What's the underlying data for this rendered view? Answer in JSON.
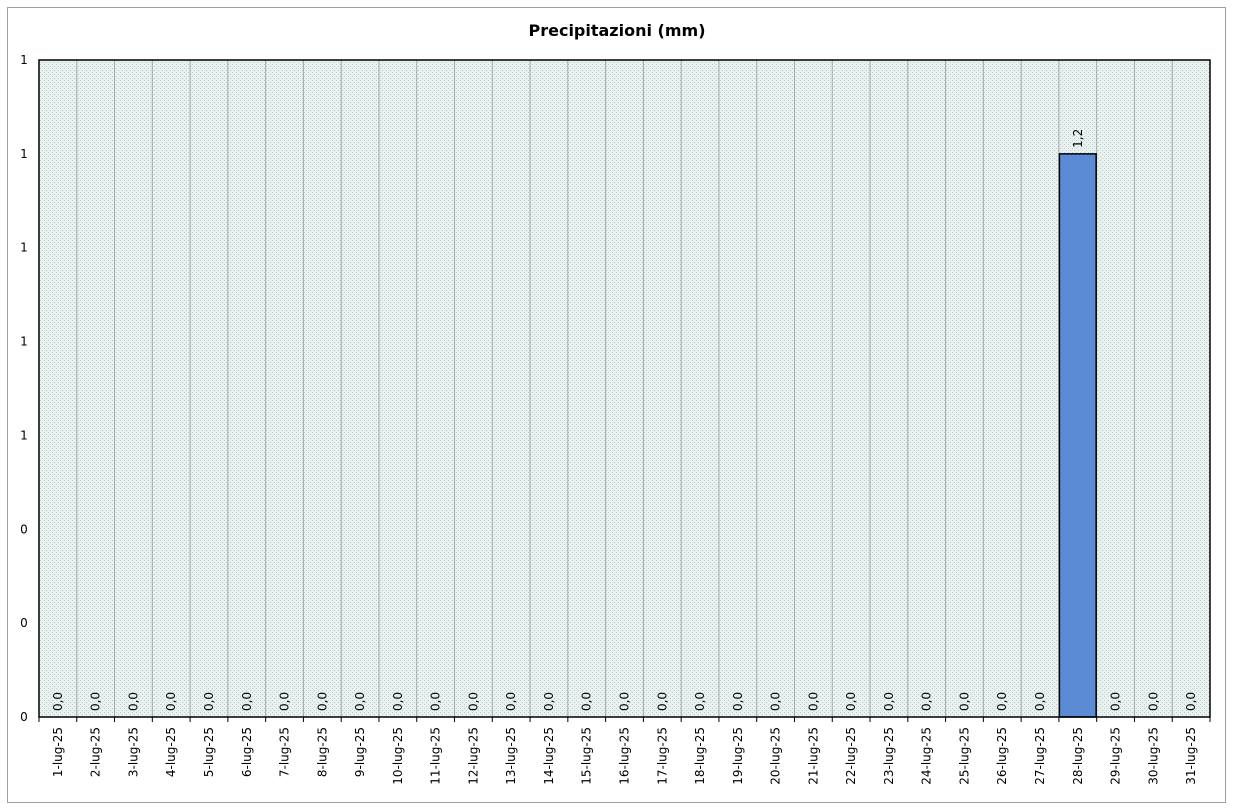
{
  "chart_data": {
    "type": "bar",
    "title": "Precipitazioni  (mm)",
    "xlabel": "",
    "ylabel": "",
    "ylim": [
      0,
      1.4
    ],
    "y_tick_labels": [
      "0",
      "0",
      "0",
      "1",
      "1",
      "1",
      "1",
      "1"
    ],
    "categories": [
      "1-lug-25",
      "2-lug-25",
      "3-lug-25",
      "4-lug-25",
      "5-lug-25",
      "6-lug-25",
      "7-lug-25",
      "8-lug-25",
      "9-lug-25",
      "10-lug-25",
      "11-lug-25",
      "12-lug-25",
      "13-lug-25",
      "14-lug-25",
      "15-lug-25",
      "16-lug-25",
      "17-lug-25",
      "18-lug-25",
      "19-lug-25",
      "20-lug-25",
      "21-lug-25",
      "22-lug-25",
      "23-lug-25",
      "24-lug-25",
      "25-lug-25",
      "26-lug-25",
      "27-lug-25",
      "28-lug-25",
      "29-lug-25",
      "30-lug-25",
      "31-lug-25"
    ],
    "values": [
      0,
      0,
      0,
      0,
      0,
      0,
      0,
      0,
      0,
      0,
      0,
      0,
      0,
      0,
      0,
      0,
      0,
      0,
      0,
      0,
      0,
      0,
      0,
      0,
      0,
      0,
      0,
      1.2,
      0,
      0,
      0
    ],
    "data_labels": [
      "0,0",
      "0,0",
      "0,0",
      "0,0",
      "0,0",
      "0,0",
      "0,0",
      "0,0",
      "0,0",
      "0,0",
      "0,0",
      "0,0",
      "0,0",
      "0,0",
      "0,0",
      "0,0",
      "0,0",
      "0,0",
      "0,0",
      "0,0",
      "0,0",
      "0,0",
      "0,0",
      "0,0",
      "0,0",
      "0,0",
      "0,0",
      "1,2",
      "0,0",
      "0,0",
      "0,0"
    ],
    "grid": true,
    "legend": "none",
    "colors": {
      "bar_fill": "#5b8bd4",
      "bar_stroke": "#000000",
      "plot_bg": "#e4efee",
      "grid_line": "#a6a6a6",
      "plot_border": "#000000"
    }
  }
}
